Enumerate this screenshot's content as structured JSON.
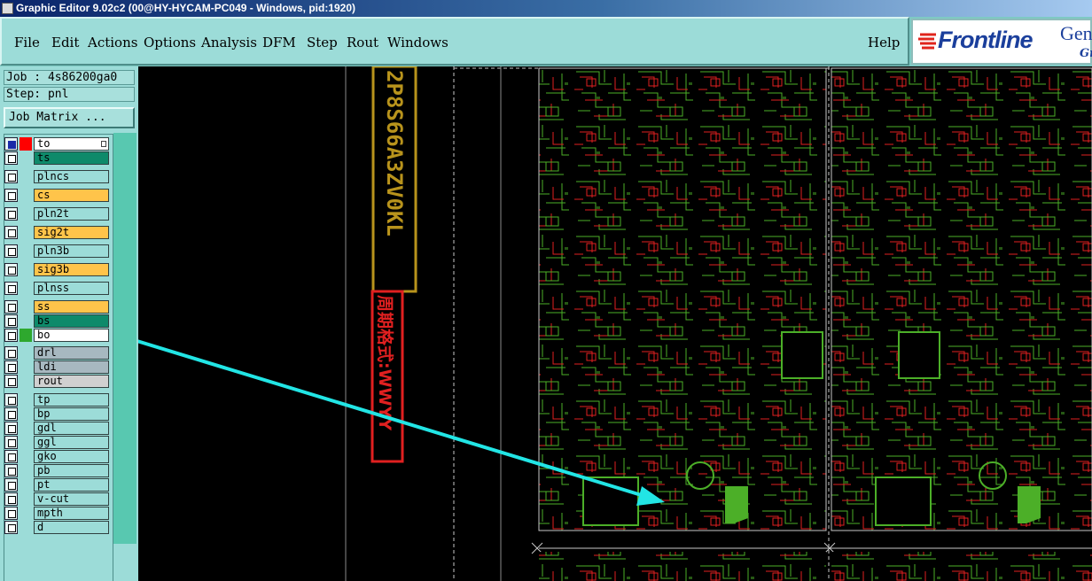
{
  "window": {
    "title": "Graphic Editor 9.02c2 (00@HY-HYCAM-PC049 - Windows, pid:1920)"
  },
  "menu": {
    "items": [
      {
        "label": "File"
      },
      {
        "label": "Edit"
      },
      {
        "label": "Actions"
      },
      {
        "label": "Options"
      },
      {
        "label": "Analysis"
      },
      {
        "label": "DFM"
      },
      {
        "label": "Step"
      },
      {
        "label": "Rout"
      },
      {
        "label": "Windows"
      }
    ],
    "help": "Help"
  },
  "brand": {
    "logo": "Frontline",
    "product": "Gen",
    "product_sub": "Gr"
  },
  "job_info": {
    "job": "Job : 4s86200ga0",
    "step": "Step: pnl",
    "matrix_button": "Job Matrix ..."
  },
  "layers": [
    {
      "name": "to",
      "color": "#ffffff",
      "swatch": "#ff0000",
      "checked": true
    },
    {
      "name": "ts",
      "color": "#0e8a6a",
      "swatch": "",
      "checked": false
    },
    {
      "name": "plncs",
      "color": "#9cdcd8",
      "swatch": "",
      "checked": false
    },
    {
      "name": "cs",
      "color": "#ffc44a",
      "swatch": "",
      "checked": false
    },
    {
      "name": "pln2t",
      "color": "#9cdcd8",
      "swatch": "",
      "checked": false
    },
    {
      "name": "sig2t",
      "color": "#ffc44a",
      "swatch": "",
      "checked": false
    },
    {
      "name": "pln3b",
      "color": "#9cdcd8",
      "swatch": "",
      "checked": false
    },
    {
      "name": "sig3b",
      "color": "#ffc44a",
      "swatch": "",
      "checked": false
    },
    {
      "name": "plnss",
      "color": "#9cdcd8",
      "swatch": "",
      "checked": false
    },
    {
      "name": "ss",
      "color": "#ffc44a",
      "swatch": "",
      "checked": false
    },
    {
      "name": "bs",
      "color": "#0e8a6a",
      "swatch": "",
      "checked": false
    },
    {
      "name": "bo",
      "color": "#ffffff",
      "swatch": "#2ea82e",
      "checked": false
    },
    {
      "name": "drl",
      "color": "#a7b8c0",
      "swatch": "",
      "checked": false
    },
    {
      "name": "ldi",
      "color": "#a7b8c0",
      "swatch": "",
      "checked": false
    },
    {
      "name": "rout",
      "color": "#d0d0d0",
      "swatch": "",
      "checked": false
    },
    {
      "name": "tp",
      "color": "#9cdcd8",
      "swatch": "",
      "checked": false
    },
    {
      "name": "bp",
      "color": "#9cdcd8",
      "swatch": "",
      "checked": false
    },
    {
      "name": "gdl",
      "color": "#9cdcd8",
      "swatch": "",
      "checked": false
    },
    {
      "name": "ggl",
      "color": "#9cdcd8",
      "swatch": "",
      "checked": false
    },
    {
      "name": "gko",
      "color": "#9cdcd8",
      "swatch": "",
      "checked": false
    },
    {
      "name": "pb",
      "color": "#9cdcd8",
      "swatch": "",
      "checked": false
    },
    {
      "name": "pt",
      "color": "#9cdcd8",
      "swatch": "",
      "checked": false
    },
    {
      "name": "v-cut",
      "color": "#9cdcd8",
      "swatch": "",
      "checked": false
    },
    {
      "name": "mpth",
      "color": "#9cdcd8",
      "swatch": "",
      "checked": false
    },
    {
      "name": "d",
      "color": "#9cdcd8",
      "swatch": "",
      "checked": false
    }
  ],
  "canvas_text": {
    "yellow_code": "2P8S66A3ZV0KL",
    "red_label": "周期格式:WWYY"
  },
  "colors": {
    "accent_arrow": "#22e5e5",
    "pcb_red": "#e02020",
    "pcb_green": "#4caf28",
    "panel_bg": "#9cdcd8"
  }
}
